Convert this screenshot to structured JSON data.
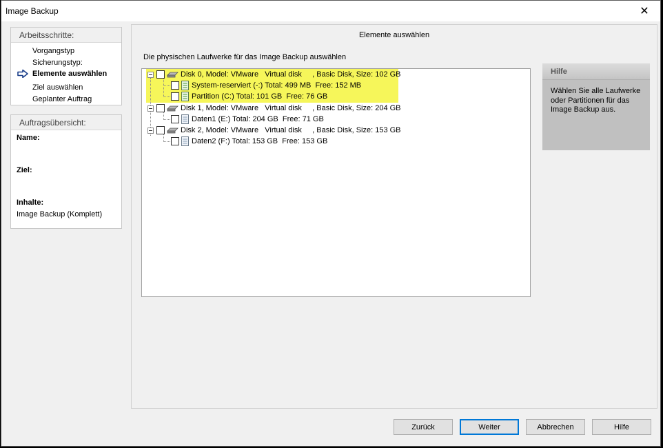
{
  "window": {
    "title": "Image Backup",
    "close_label": "✕"
  },
  "steps": {
    "header": "Arbeitsschritte:",
    "items": [
      "Vorgangstyp",
      "Sicherungstyp:",
      "Elemente auswählen",
      "Ziel auswählen",
      "Geplanter Auftrag"
    ],
    "active_index": 2
  },
  "summary": {
    "header": "Auftragsübersicht:",
    "name_label": "Name:",
    "target_label": "Ziel:",
    "contents_label": "Inhalte:",
    "contents_value": "Image Backup (Komplett)"
  },
  "main": {
    "title": "Elemente auswählen",
    "instruction": "Die physischen Laufwerke für das Image Backup auswählen"
  },
  "tree": {
    "disks": [
      {
        "label": "Disk 0, Model: VMware   Virtual disk     , Basic Disk, Size: 102 GB",
        "checked": false,
        "partitions": [
          {
            "label": "System-reserviert (-:) Total: 499 MB  Free: 152 MB",
            "checked": false
          },
          {
            "label": "Partition (C:) Total: 101 GB  Free: 76 GB",
            "checked": false
          }
        ]
      },
      {
        "label": "Disk 1, Model: VMware   Virtual disk     , Basic Disk, Size: 204 GB",
        "checked": false,
        "partitions": [
          {
            "label": "Daten1 (E:) Total: 204 GB  Free: 71 GB",
            "checked": false
          }
        ]
      },
      {
        "label": "Disk 2, Model: VMware   Virtual disk     , Basic Disk, Size: 153 GB",
        "checked": false,
        "partitions": [
          {
            "label": "Daten2 (F:) Total: 153 GB  Free: 153 GB",
            "checked": false
          }
        ]
      }
    ],
    "highlight_color": "#f6f65a"
  },
  "help": {
    "header": "Hilfe",
    "text": "Wählen Sie alle Laufwerke oder Partitionen für das Image Backup aus."
  },
  "buttons": {
    "back": "Zurück",
    "next": "Weiter",
    "cancel": "Abbrechen",
    "help": "Hilfe"
  }
}
